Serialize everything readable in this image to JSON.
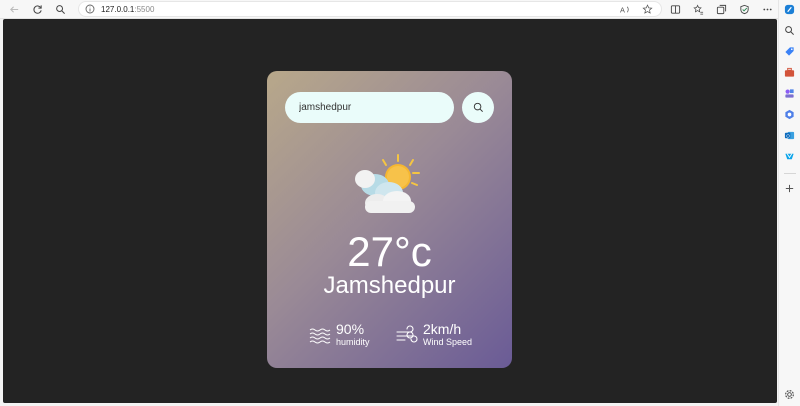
{
  "browser": {
    "url_host": "127.0.0.1",
    "url_port": ":5500"
  },
  "search": {
    "value": "jamshedpur"
  },
  "weather": {
    "temperature": "27°c",
    "city": "Jamshedpur",
    "humidity_value": "90%",
    "humidity_label": "humidity",
    "wind_value": "2km/h",
    "wind_label": "Wind Speed"
  }
}
